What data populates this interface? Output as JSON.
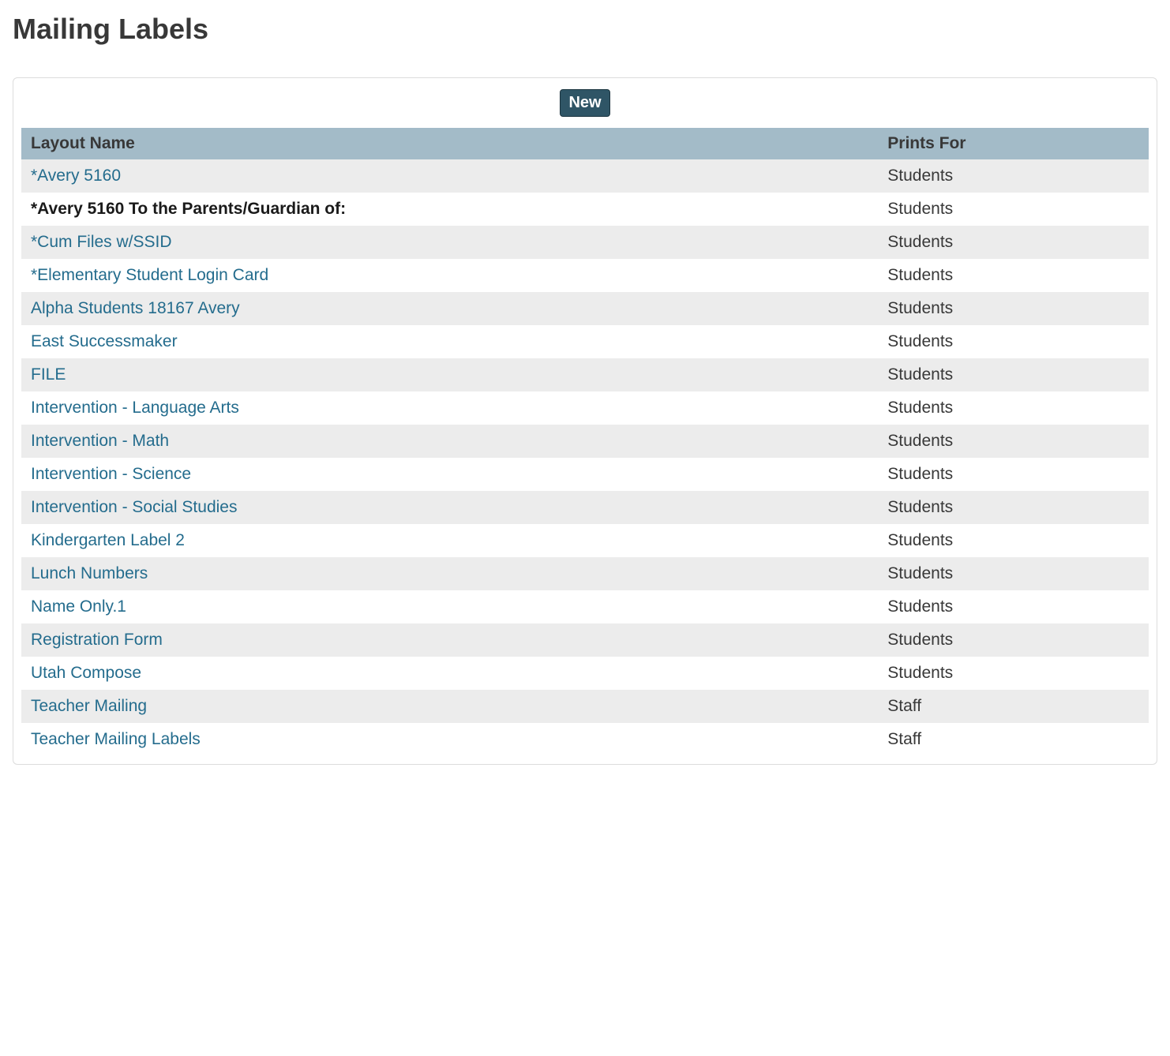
{
  "page": {
    "title": "Mailing Labels"
  },
  "toolbar": {
    "new_label": "New"
  },
  "table": {
    "headers": {
      "layout_name": "Layout Name",
      "prints_for": "Prints For"
    },
    "rows": [
      {
        "layout_name": "*Avery 5160",
        "prints_for": "Students",
        "link": true
      },
      {
        "layout_name": "*Avery 5160 To the Parents/Guardian of:",
        "prints_for": "Students",
        "link": false
      },
      {
        "layout_name": "*Cum Files w/SSID",
        "prints_for": "Students",
        "link": true
      },
      {
        "layout_name": "*Elementary Student Login Card",
        "prints_for": "Students",
        "link": true
      },
      {
        "layout_name": "Alpha Students 18167 Avery",
        "prints_for": "Students",
        "link": true
      },
      {
        "layout_name": "East Successmaker",
        "prints_for": "Students",
        "link": true
      },
      {
        "layout_name": "FILE",
        "prints_for": "Students",
        "link": true
      },
      {
        "layout_name": "Intervention - Language Arts",
        "prints_for": "Students",
        "link": true
      },
      {
        "layout_name": "Intervention - Math",
        "prints_for": "Students",
        "link": true
      },
      {
        "layout_name": "Intervention - Science",
        "prints_for": "Students",
        "link": true
      },
      {
        "layout_name": "Intervention - Social Studies",
        "prints_for": "Students",
        "link": true
      },
      {
        "layout_name": "Kindergarten Label 2",
        "prints_for": "Students",
        "link": true
      },
      {
        "layout_name": "Lunch Numbers",
        "prints_for": "Students",
        "link": true
      },
      {
        "layout_name": "Name Only.1",
        "prints_for": "Students",
        "link": true
      },
      {
        "layout_name": "Registration Form",
        "prints_for": "Students",
        "link": true
      },
      {
        "layout_name": "Utah Compose",
        "prints_for": "Students",
        "link": true
      },
      {
        "layout_name": "Teacher Mailing",
        "prints_for": "Staff",
        "link": true
      },
      {
        "layout_name": "Teacher Mailing Labels",
        "prints_for": "Staff",
        "link": true
      }
    ]
  }
}
